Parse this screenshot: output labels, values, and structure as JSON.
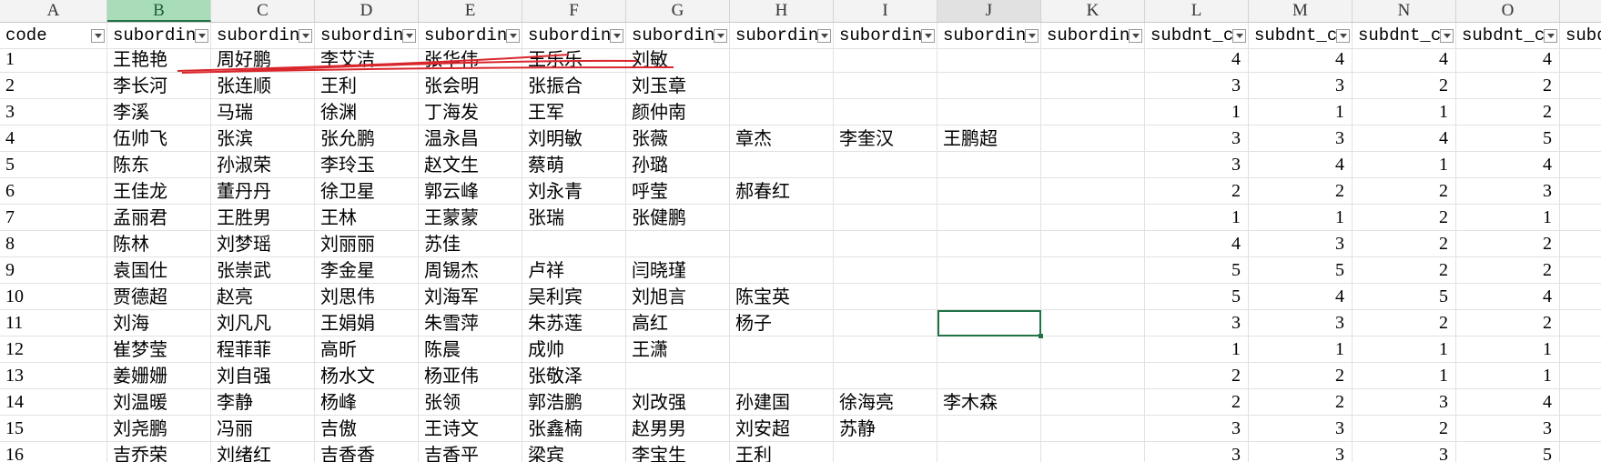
{
  "columns": [
    "A",
    "B",
    "C",
    "D",
    "E",
    "F",
    "G",
    "H",
    "I",
    "J",
    "K",
    "L",
    "M",
    "N",
    "O"
  ],
  "selected_column": "B",
  "active_cell": "J11",
  "header_row": [
    "code",
    "subordin",
    "subordin",
    "subordin",
    "subordin",
    "subordin",
    "subordin",
    "subordin",
    "subordin",
    "subordin",
    "subordin",
    "subdnt_c",
    "subdnt_c",
    "subdnt_c",
    "subdnt_c",
    "subd"
  ],
  "rows": [
    [
      "1",
      "王艳艳",
      "周好鹏",
      "李艾洁",
      "张华伟",
      "王乐乐",
      "刘敏",
      "",
      "",
      "",
      "",
      "4",
      "4",
      "4",
      "4"
    ],
    [
      "2",
      "李长河",
      "张连顺",
      "王利",
      "张会明",
      "张振合",
      "刘玉章",
      "",
      "",
      "",
      "",
      "3",
      "3",
      "2",
      "2"
    ],
    [
      "3",
      "李溪",
      "马瑞",
      "徐渊",
      "丁海发",
      "王军",
      "颜仲南",
      "",
      "",
      "",
      "",
      "1",
      "1",
      "1",
      "2"
    ],
    [
      "4",
      "伍帅飞",
      "张滨",
      "张允鹏",
      "温永昌",
      "刘明敏",
      "张薇",
      "章杰",
      "李奎汉",
      "王鹏超",
      "",
      "3",
      "3",
      "4",
      "5"
    ],
    [
      "5",
      "陈东",
      "孙淑荣",
      "李玲玉",
      "赵文生",
      "蔡萌",
      "孙璐",
      "",
      "",
      "",
      "",
      "3",
      "4",
      "1",
      "4"
    ],
    [
      "6",
      "王佳龙",
      "董丹丹",
      "徐卫星",
      "郭云峰",
      "刘永青",
      "呼莹",
      "郝春红",
      "",
      "",
      "",
      "2",
      "2",
      "2",
      "3"
    ],
    [
      "7",
      "孟丽君",
      "王胜男",
      "王林",
      "王蒙蒙",
      "张瑞",
      "张健鹏",
      "",
      "",
      "",
      "",
      "1",
      "1",
      "2",
      "1"
    ],
    [
      "8",
      "陈林",
      "刘梦瑶",
      "刘丽丽",
      "苏佳",
      "",
      "",
      "",
      "",
      "",
      "",
      "4",
      "3",
      "2",
      "2"
    ],
    [
      "9",
      "袁国仕",
      "张崇武",
      "李金星",
      "周锡杰",
      "卢祥",
      "闫晓瑾",
      "",
      "",
      "",
      "",
      "5",
      "5",
      "2",
      "2"
    ],
    [
      "10",
      "贾德超",
      "赵亮",
      "刘思伟",
      "刘海军",
      "吴利宾",
      "刘旭言",
      "陈宝英",
      "",
      "",
      "",
      "5",
      "4",
      "5",
      "4"
    ],
    [
      "11",
      "刘海",
      "刘凡凡",
      "王娟娟",
      "朱雪萍",
      "朱苏莲",
      "高红",
      "杨子",
      "",
      "",
      "",
      "3",
      "3",
      "2",
      "2"
    ],
    [
      "12",
      "崔梦莹",
      "程菲菲",
      "高昕",
      "陈晨",
      "成帅",
      "王潇",
      "",
      "",
      "",
      "",
      "1",
      "1",
      "1",
      "1"
    ],
    [
      "13",
      "姜姗姗",
      "刘自强",
      "杨水文",
      "杨亚伟",
      "张敬泽",
      "",
      "",
      "",
      "",
      "",
      "2",
      "2",
      "1",
      "1"
    ],
    [
      "14",
      "刘温暖",
      "李静",
      "杨峰",
      "张领",
      "郭浩鹏",
      "刘改强",
      "孙建国",
      "徐海亮",
      "李木森",
      "",
      "2",
      "2",
      "3",
      "4"
    ],
    [
      "15",
      "刘尧鹏",
      "冯丽",
      "吉傲",
      "王诗文",
      "张鑫楠",
      "赵男男",
      "刘安超",
      "苏静",
      "",
      "",
      "3",
      "3",
      "2",
      "3"
    ],
    [
      "16",
      "吉乔荣",
      "刘绪红",
      "吉香香",
      "吉香平",
      "梁宾",
      "李宝生",
      "王利",
      "",
      "",
      "",
      "3",
      "3",
      "3",
      "5"
    ]
  ],
  "annotation_color": "#d9262c"
}
